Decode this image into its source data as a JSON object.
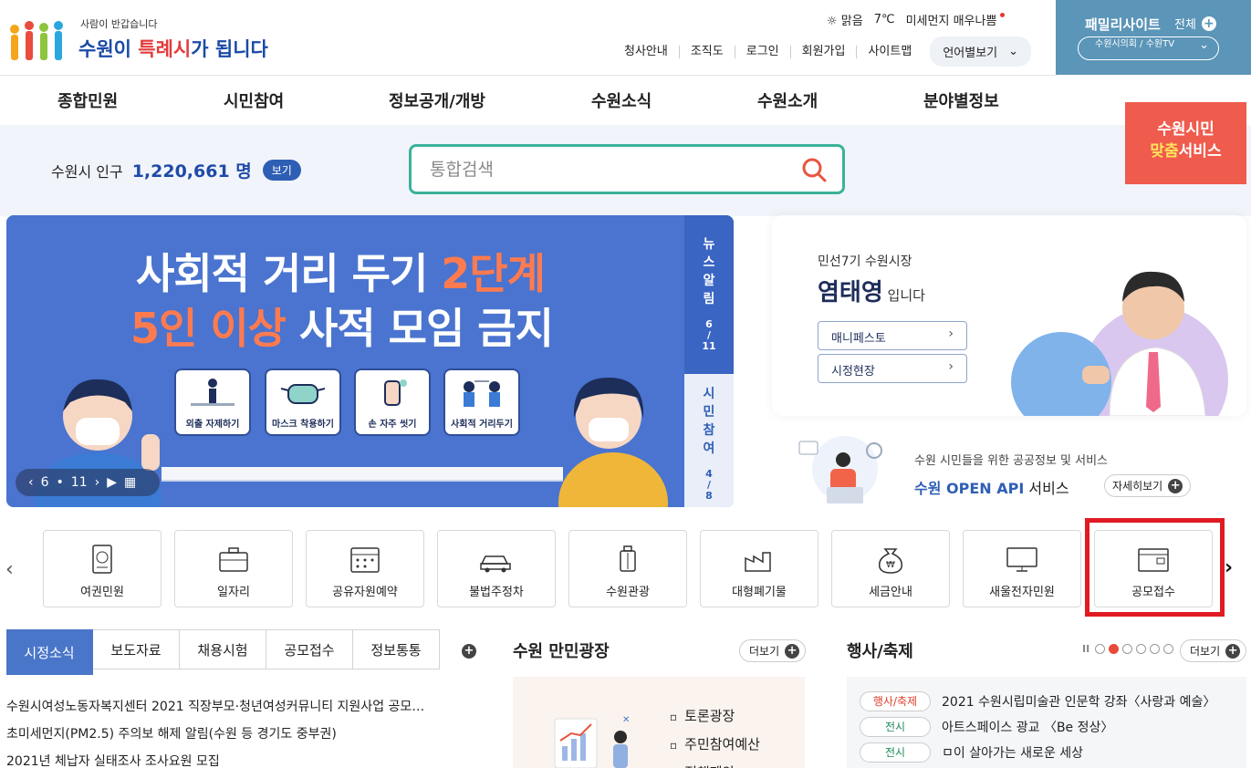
{
  "header": {
    "logo_sub": "사람이 반갑습니다",
    "logo_main_1": "수원이",
    "logo_main_2": "특례시",
    "logo_main_3": "가 됩니다",
    "weather": "맑음",
    "temp": "7℃",
    "dust": "미세먼지 매우나쁨",
    "util": [
      "청사안내",
      "조직도",
      "로그인",
      "회원가입",
      "사이트맵"
    ],
    "lang": "언어별보기",
    "family_title": "패밀리사이트",
    "family_all": "전체",
    "family_select": "수원시의회 / 수원TV"
  },
  "gnb": [
    "종합민원",
    "시민참여",
    "정보공개/개방",
    "수원소식",
    "수원소개",
    "분야별정보"
  ],
  "custom_service": {
    "line1": "수원시민",
    "line2a": "맞춤",
    "line2b": "서비스"
  },
  "population": {
    "label": "수원시 인구",
    "value": "1,220,661 명",
    "btn": "보기"
  },
  "search": {
    "placeholder": "통합검색"
  },
  "banner": {
    "line1a": "사회적 거리 두기 ",
    "line1b": "2단계",
    "line2a": "5인 이상",
    "line2b": " 사적 모임 금지",
    "cards": [
      "외출 자제하기",
      "마스크 착용하기",
      "손 자주 씻기",
      "사회적 거리두기"
    ],
    "ctrl_current": "6",
    "ctrl_total": "11",
    "side1_label": [
      "뉴",
      "스",
      "알",
      "림"
    ],
    "side1_page_a": "6",
    "side1_page_sep": "/",
    "side1_page_b": "11",
    "side2_label": [
      "시",
      "민",
      "참",
      "여"
    ],
    "side2_page_a": "4",
    "side2_page_sep": "/",
    "side2_page_b": "8"
  },
  "mayor": {
    "sub": "민선7기 수원시장",
    "name": "염태영",
    "suffix": " 입니다",
    "btn1": "매니페스토",
    "btn2": "시정현장"
  },
  "api": {
    "small": "수원 시민들을 위한 공공정보 및 서비스",
    "big_a": "수원 OPEN API",
    "big_b": " 서비스",
    "more": "자세히보기"
  },
  "quick": [
    "여권민원",
    "일자리",
    "공유자원예약",
    "불법주정차",
    "수원관광",
    "대형폐기물",
    "세금안내",
    "새울전자민원",
    "공모접수"
  ],
  "news_tabs": [
    "시정소식",
    "보도자료",
    "채용시험",
    "공모접수",
    "정보통통"
  ],
  "news": [
    "수원시여성노동자복지센터 2021 직장부모·청년여성커뮤니티 지원사업 공모…",
    "초미세먼지(PM2.5) 주의보 해제 알림(수원 등 경기도 중부권)",
    "2021년 체납자 실태조사 조사요원 모집"
  ],
  "plaza": {
    "title": "수원 만민광장",
    "more": "더보기",
    "items": [
      "토론광장",
      "주민참여예산",
      "정책제안"
    ]
  },
  "events": {
    "title": "행사/축제",
    "more": "더보기",
    "pause": "II",
    "rows": [
      {
        "badge": "행사/축제",
        "text": "2021 수원시립미술관 인문학 강좌〈사랑과 예술〉"
      },
      {
        "badge": "전시",
        "text": "아트스페이스 광교 〈Be 정상〉"
      },
      {
        "badge": "전시",
        "text": "ㅁ이 살아가는 새로운 세상"
      }
    ]
  }
}
